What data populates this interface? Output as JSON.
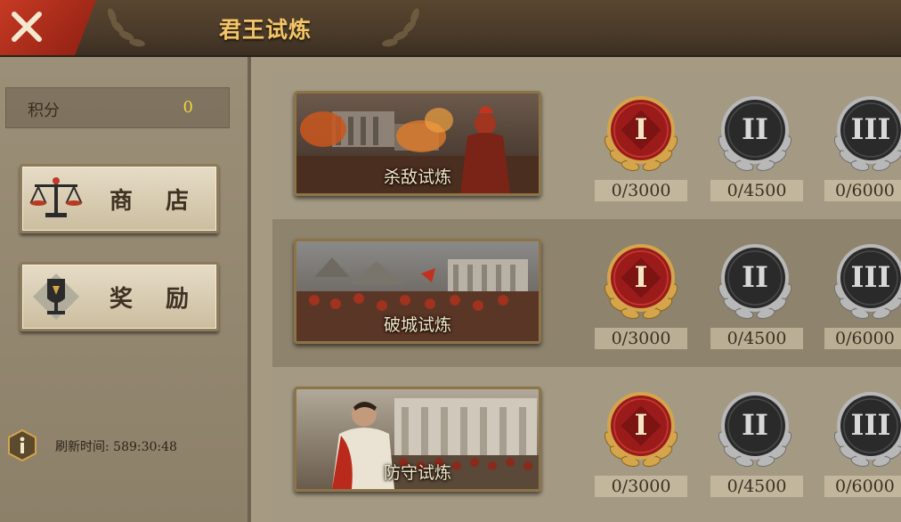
{
  "header": {
    "title": "君王试炼"
  },
  "sidebar": {
    "score_label": "积分",
    "score_value": "0",
    "shop_label": "商 店",
    "reward_label": "奖 励",
    "refresh_text": "刷新时间: 589:30:48"
  },
  "trials": [
    {
      "name": "杀敌试炼",
      "tiers": [
        {
          "numeral": "I",
          "progress": "0/3000"
        },
        {
          "numeral": "II",
          "progress": "0/4500"
        },
        {
          "numeral": "III",
          "progress": "0/6000"
        }
      ]
    },
    {
      "name": "破城试炼",
      "tiers": [
        {
          "numeral": "I",
          "progress": "0/3000"
        },
        {
          "numeral": "II",
          "progress": "0/4500"
        },
        {
          "numeral": "III",
          "progress": "0/6000"
        }
      ]
    },
    {
      "name": "防守试炼",
      "tiers": [
        {
          "numeral": "I",
          "progress": "0/3000"
        },
        {
          "numeral": "II",
          "progress": "0/4500"
        },
        {
          "numeral": "III",
          "progress": "0/6000"
        }
      ]
    }
  ],
  "colors": {
    "title_gold": "#f3c567",
    "score_yellow": "#f0d23c",
    "medal_red": "#9b1b1b",
    "medal_dark": "#2a2a2a",
    "wreath_gold": "#d4a54a",
    "wreath_silver": "#b8b8b8"
  }
}
